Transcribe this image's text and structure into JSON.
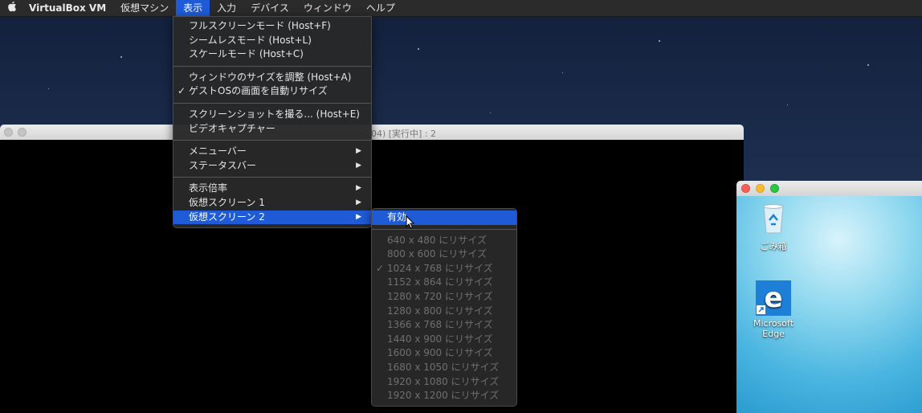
{
  "menubar": {
    "app": "VirtualBox VM",
    "items": [
      "仮想マシン",
      "表示",
      "入力",
      "デバイス",
      "ウィンドウ",
      "ヘルプ"
    ],
    "active_index": 1
  },
  "vm_window": {
    "title": "-04) [実行中] : 2"
  },
  "view_menu": {
    "groups": [
      [
        {
          "label": "フルスクリーンモード (Host+F)",
          "check": "",
          "arrow": ""
        },
        {
          "label": "シームレスモード (Host+L)",
          "check": "",
          "arrow": ""
        },
        {
          "label": "スケールモード (Host+C)",
          "check": "",
          "arrow": ""
        }
      ],
      [
        {
          "label": "ウィンドウのサイズを調整 (Host+A)",
          "check": "",
          "arrow": ""
        },
        {
          "label": "ゲストOSの画面を自動リサイズ",
          "check": "✓",
          "arrow": ""
        }
      ],
      [
        {
          "label": "スクリーンショットを撮る... (Host+E)",
          "check": "",
          "arrow": ""
        },
        {
          "label": "ビデオキャプチャー",
          "check": "",
          "arrow": ""
        }
      ],
      [
        {
          "label": "メニューバー",
          "check": "",
          "arrow": "▶"
        },
        {
          "label": "ステータスバー",
          "check": "",
          "arrow": "▶"
        }
      ],
      [
        {
          "label": "表示倍率",
          "check": "",
          "arrow": "▶"
        },
        {
          "label": "仮想スクリーン 1",
          "check": "",
          "arrow": "▶"
        },
        {
          "label": "仮想スクリーン 2",
          "check": "",
          "arrow": "▶",
          "highlighted": true
        }
      ]
    ]
  },
  "submenu": {
    "enable_label": "有効",
    "resize_items": [
      {
        "label": "640 x 480 にリサイズ",
        "check": ""
      },
      {
        "label": "800 x 600 にリサイズ",
        "check": ""
      },
      {
        "label": "1024 x 768 にリサイズ",
        "check": "✓"
      },
      {
        "label": "1152 x 864 にリサイズ",
        "check": ""
      },
      {
        "label": "1280 x 720 にリサイズ",
        "check": ""
      },
      {
        "label": "1280 x 800 にリサイズ",
        "check": ""
      },
      {
        "label": "1366 x 768 にリサイズ",
        "check": ""
      },
      {
        "label": "1440 x 900 にリサイズ",
        "check": ""
      },
      {
        "label": "1600 x 900 にリサイズ",
        "check": ""
      },
      {
        "label": "1680 x 1050 にリサイズ",
        "check": ""
      },
      {
        "label": "1920 x 1080 にリサイズ",
        "check": ""
      },
      {
        "label": "1920 x 1200 にリサイズ",
        "check": ""
      }
    ]
  },
  "guest_desktop": {
    "icons": [
      {
        "name": "recycle-bin",
        "label": "ごみ箱"
      },
      {
        "name": "edge",
        "label": "Microsoft Edge"
      }
    ]
  },
  "colors": {
    "highlight": "#1f5bd6",
    "menu_bg": "#282828",
    "close": "#fc5f57",
    "minimize": "#fdbc2e",
    "zoom": "#28c840"
  }
}
